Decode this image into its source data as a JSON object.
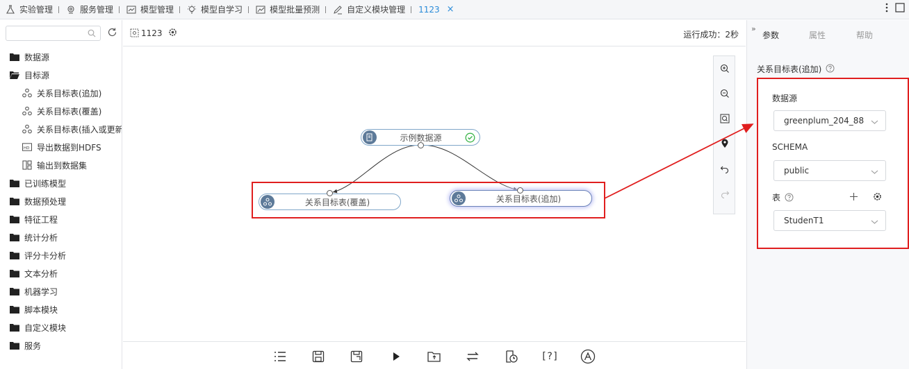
{
  "tabs": [
    {
      "label": "实验管理",
      "icon": "flask-icon"
    },
    {
      "label": "服务管理",
      "icon": "service-icon"
    },
    {
      "label": "模型管理",
      "icon": "model-chart-icon"
    },
    {
      "label": "模型自学习",
      "icon": "lightbulb-icon"
    },
    {
      "label": "模型批量预测",
      "icon": "trend-chart-icon"
    },
    {
      "label": "自定义模块管理",
      "icon": "edit-icon"
    }
  ],
  "active_tab": {
    "label": "1123",
    "close": "×"
  },
  "sidebar": {
    "search_placeholder": "",
    "tree": [
      {
        "label": "数据源",
        "type": "folder",
        "open": false
      },
      {
        "label": "目标源",
        "type": "folder",
        "open": true
      },
      {
        "label": "关系目标表(追加)",
        "type": "leaf",
        "icon": "relation-node-icon"
      },
      {
        "label": "关系目标表(覆盖)",
        "type": "leaf",
        "icon": "relation-node-icon"
      },
      {
        "label": "关系目标表(插入或更新)",
        "type": "leaf",
        "icon": "relation-node-icon"
      },
      {
        "label": "导出数据到HDFS",
        "type": "leaf",
        "icon": "hdfs-icon"
      },
      {
        "label": "输出到数据集",
        "type": "leaf",
        "icon": "dataset-icon"
      },
      {
        "label": "已训练模型",
        "type": "folder",
        "open": false
      },
      {
        "label": "数据预处理",
        "type": "folder",
        "open": false
      },
      {
        "label": "特征工程",
        "type": "folder",
        "open": false
      },
      {
        "label": "统计分析",
        "type": "folder",
        "open": false
      },
      {
        "label": "评分卡分析",
        "type": "folder",
        "open": false
      },
      {
        "label": "文本分析",
        "type": "folder",
        "open": false
      },
      {
        "label": "机器学习",
        "type": "folder",
        "open": false
      },
      {
        "label": "脚本模块",
        "type": "folder",
        "open": false
      },
      {
        "label": "自定义模块",
        "type": "folder",
        "open": false
      },
      {
        "label": "服务",
        "type": "folder",
        "open": false
      }
    ]
  },
  "main": {
    "flow_name": "1123",
    "run_status": "运行成功：2秒",
    "nodes": {
      "source": "示例数据源",
      "overwrite": "关系目标表(覆盖)",
      "append": "关系目标表(追加)"
    }
  },
  "right_panel": {
    "tabs": [
      "参数",
      "属性",
      "帮助"
    ],
    "active_tab": "参数",
    "title": "关系目标表(追加)",
    "datasource_label": "数据源",
    "datasource_value": "greenplum_204_88",
    "schema_label": "SCHEMA",
    "schema_value": "public",
    "table_label": "表",
    "table_value": "StudenT1"
  },
  "colors": {
    "accent": "#2a8bd8",
    "annotation_red": "#e01e1e",
    "node_icon_bg": "#5d7a99",
    "success_green": "#3bb54a"
  }
}
